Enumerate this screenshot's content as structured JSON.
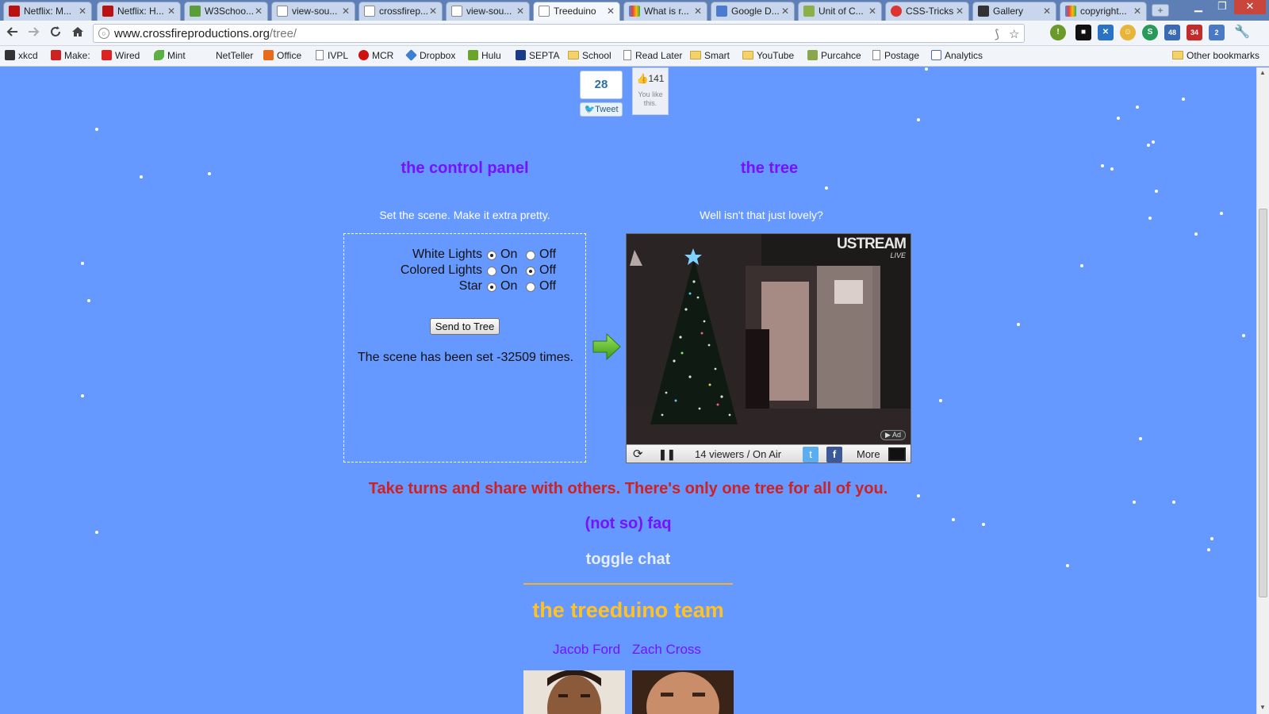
{
  "browser": {
    "tabs": [
      {
        "title": "Netflix: M...",
        "active": false,
        "icon": "netflix-icon"
      },
      {
        "title": "Netflix: H...",
        "active": false,
        "icon": "netflix-icon"
      },
      {
        "title": "W3Schoo...",
        "active": false,
        "icon": "w3schools-icon"
      },
      {
        "title": "view-sou...",
        "active": false,
        "icon": "page-icon"
      },
      {
        "title": "crossfirep...",
        "active": false,
        "icon": "page-icon"
      },
      {
        "title": "view-sou...",
        "active": false,
        "icon": "page-icon"
      },
      {
        "title": "Treeduino",
        "active": true,
        "icon": "page-icon"
      },
      {
        "title": "What is r...",
        "active": false,
        "icon": "google-icon"
      },
      {
        "title": "Google D...",
        "active": false,
        "icon": "google-docs-icon"
      },
      {
        "title": "Unit of C...",
        "active": false,
        "icon": "doc-icon"
      },
      {
        "title": "CSS-Tricks",
        "active": false,
        "icon": "css-tricks-icon"
      },
      {
        "title": "Gallery",
        "active": false,
        "icon": "zenfolio-icon"
      },
      {
        "title": "copyright...",
        "active": false,
        "icon": "google-icon"
      }
    ],
    "url": {
      "host": "www.crossfireproductions.org",
      "path": "/tree/"
    },
    "extensions": {
      "gmail_badge": "48",
      "mail_badge": "34",
      "ext_badge": "2"
    },
    "bookmarks": [
      {
        "label": "xkcd",
        "icon": "xkcd-icon"
      },
      {
        "label": "Make:",
        "icon": "make-icon"
      },
      {
        "label": "Wired",
        "icon": "wired-icon"
      },
      {
        "label": "Mint",
        "icon": "mint-icon"
      },
      {
        "label": "NetTeller",
        "icon": "netteller-icon"
      },
      {
        "label": "Office",
        "icon": "office-icon"
      },
      {
        "label": "IVPL",
        "icon": "page-icon"
      },
      {
        "label": "MCR",
        "icon": "mcr-icon"
      },
      {
        "label": "Dropbox",
        "icon": "dropbox-icon"
      },
      {
        "label": "Hulu",
        "icon": "hulu-icon"
      },
      {
        "label": "SEPTA",
        "icon": "septa-icon"
      },
      {
        "label": "School",
        "icon": "folder-icon"
      },
      {
        "label": "Read Later",
        "icon": "page-icon"
      },
      {
        "label": "Smart",
        "icon": "folder-icon"
      },
      {
        "label": "YouTube",
        "icon": "folder-icon"
      },
      {
        "label": "Purcahce",
        "icon": "purchase-icon"
      },
      {
        "label": "Postage",
        "icon": "page-icon"
      },
      {
        "label": "Analytics",
        "icon": "analytics-icon"
      }
    ],
    "other_bookmarks": "Other bookmarks"
  },
  "social": {
    "tweet_count": "28",
    "tweet_label": "Tweet",
    "like_count": "141",
    "like_text": "You like this."
  },
  "control_panel": {
    "heading": "the control panel",
    "subtitle": "Set the scene. Make it extra pretty.",
    "options": [
      {
        "label": "White Lights",
        "on_label": "On",
        "off_label": "Off",
        "selected": "on"
      },
      {
        "label": "Colored Lights",
        "on_label": "On",
        "off_label": "Off",
        "selected": "off"
      },
      {
        "label": "Star",
        "on_label": "On",
        "off_label": "Off",
        "selected": "on"
      }
    ],
    "send_button": "Send to Tree",
    "count_text": "The scene has been set -32509 times."
  },
  "tree": {
    "heading": "the tree",
    "subtitle": "Well isn't that just lovely?",
    "player": {
      "brand": "USTREAM",
      "brand_sub": "LIVE",
      "ad_label": "Ad",
      "viewers": "14 viewers / On Air",
      "more_label": "More"
    }
  },
  "footer": {
    "share_text": "Take turns and share with others. There's only one tree for all of you.",
    "faq_link": "(not so) faq",
    "toggle_chat": "toggle chat",
    "team_heading": "the treeduino team",
    "members": [
      "Jacob Ford",
      "Zach Cross"
    ]
  },
  "colors": {
    "page_background": "#6699ff",
    "heading_purple": "#7711ff",
    "share_red": "#cc2222",
    "team_gold": "#ffc225"
  }
}
